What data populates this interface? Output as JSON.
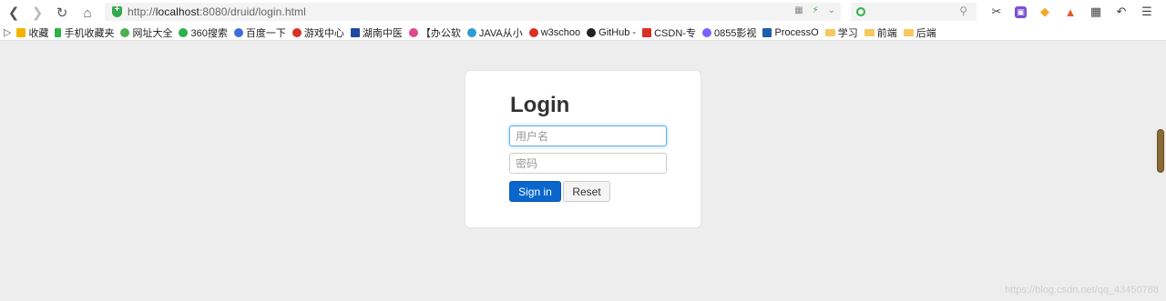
{
  "browser": {
    "url_prefix": "http://",
    "url_host": "localhost",
    "url_rest": ":8080/druid/login.html"
  },
  "bookmarks": [
    {
      "label": "收藏",
      "color": "#f5b400"
    },
    {
      "label": "手机收藏夹",
      "color": "#2fb14a"
    },
    {
      "label": "网址大全",
      "color": "#4caf50"
    },
    {
      "label": "360搜索",
      "color": "#2fb14a"
    },
    {
      "label": "百度一下",
      "color": "#3b6fd8"
    },
    {
      "label": "游戏中心",
      "color": "#d93025"
    },
    {
      "label": "湖南中医",
      "color": "#1f4aa0"
    },
    {
      "label": "【办公软",
      "color": "#e04a8c"
    },
    {
      "label": "JAVA从小",
      "color": "#2c9ad6"
    },
    {
      "label": "w3schoo",
      "color": "#d93025"
    },
    {
      "label": "GitHub -",
      "color": "#222222"
    },
    {
      "label": "CSDN-专",
      "color": "#d93025"
    },
    {
      "label": "0855影视",
      "color": "#7b61ff"
    },
    {
      "label": "ProcessO",
      "color": "#1f5ea8"
    },
    {
      "label": "学习",
      "folder": true
    },
    {
      "label": "前端",
      "folder": true
    },
    {
      "label": "后端",
      "folder": true
    }
  ],
  "login": {
    "title": "Login",
    "username_placeholder": "用户名",
    "password_placeholder": "密码",
    "signin_label": "Sign in",
    "reset_label": "Reset"
  },
  "watermark": "https://blog.csdn.net/qq_43450788"
}
